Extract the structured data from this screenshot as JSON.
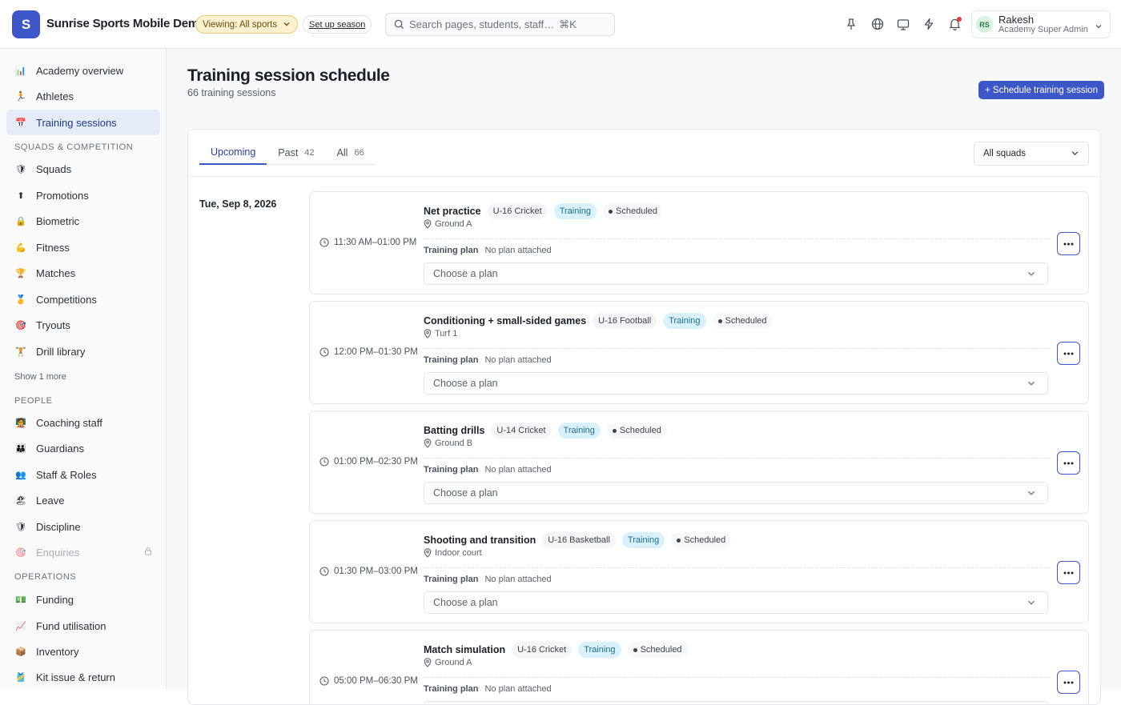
{
  "app": {
    "logo_letter": "S",
    "title": "Sunrise Sports Mobile Demo"
  },
  "header": {
    "viewing_label": "Viewing: All sports",
    "setup_label": "Set up season",
    "search_placeholder": "Search pages, students, staff…",
    "search_shortcut": "⌘K",
    "icons": [
      "pin-icon",
      "globe-icon",
      "monitor-icon",
      "lightning-icon",
      "bell-icon"
    ],
    "user": {
      "initials": "RS",
      "name": "Rakesh",
      "role": "Academy Super Admin"
    }
  },
  "sidebar": {
    "top_items": [
      {
        "emoji": "📊",
        "label": "Academy overview"
      },
      {
        "emoji": "🏃",
        "label": "Athletes"
      },
      {
        "emoji": "📅",
        "label": "Training sessions",
        "active": true
      }
    ],
    "sections": [
      {
        "label": "SQUADS & COMPETITION",
        "items": [
          {
            "emoji": "🛡",
            "label": "Squads"
          },
          {
            "emoji": "⬆",
            "label": "Promotions"
          },
          {
            "emoji": "🔒",
            "label": "Biometric"
          },
          {
            "emoji": "💪",
            "label": "Fitness"
          },
          {
            "emoji": "🏆",
            "label": "Matches"
          },
          {
            "emoji": "🥇",
            "label": "Competitions"
          },
          {
            "emoji": "🎯",
            "label": "Tryouts"
          },
          {
            "emoji": "🏋",
            "label": "Drill library"
          }
        ],
        "show_more": "Show 1 more"
      },
      {
        "label": "PEOPLE",
        "items": [
          {
            "emoji": "🧑‍🏫",
            "label": "Coaching staff"
          },
          {
            "emoji": "👪",
            "label": "Guardians"
          },
          {
            "emoji": "👥",
            "label": "Staff & Roles"
          },
          {
            "emoji": "🏖",
            "label": "Leave"
          },
          {
            "emoji": "🛡",
            "label": "Discipline"
          },
          {
            "emoji": "🎯",
            "label": "Enquiries",
            "locked": true
          }
        ]
      },
      {
        "label": "OPERATIONS",
        "items": [
          {
            "emoji": "💵",
            "label": "Funding"
          },
          {
            "emoji": "📈",
            "label": "Fund utilisation"
          },
          {
            "emoji": "📦",
            "label": "Inventory"
          },
          {
            "emoji": "🎽",
            "label": "Kit issue & return"
          }
        ]
      }
    ]
  },
  "main": {
    "title": "Training session schedule",
    "subtitle": "66 training sessions",
    "primary_button": "+ Schedule training session",
    "tabs": [
      {
        "label": "Upcoming",
        "count": "",
        "active": true
      },
      {
        "label": "Past",
        "count": "42"
      },
      {
        "label": "All",
        "count": "66"
      }
    ],
    "squad_filter": "All squads",
    "date": "Tue, Sep 8, 2026",
    "plan_label": "Training plan",
    "plan_value": "No plan attached",
    "plan_placeholder": "Choose a plan",
    "sessions": [
      {
        "time": "11:30 AM–01:00 PM",
        "title": "Net practice",
        "squad": "U-16 Cricket",
        "type": "Training",
        "status": "Scheduled",
        "location": "Ground A"
      },
      {
        "time": "12:00 PM–01:30 PM",
        "title": "Conditioning + small-sided games",
        "squad": "U-16 Football",
        "type": "Training",
        "status": "Scheduled",
        "location": "Turf 1"
      },
      {
        "time": "01:00 PM–02:30 PM",
        "title": "Batting drills",
        "squad": "U-14 Cricket",
        "type": "Training",
        "status": "Scheduled",
        "location": "Ground B"
      },
      {
        "time": "01:30 PM–03:00 PM",
        "title": "Shooting and transition",
        "squad": "U-16 Basketball",
        "type": "Training",
        "status": "Scheduled",
        "location": "Indoor court"
      },
      {
        "time": "05:00 PM–06:30 PM",
        "title": "Match simulation",
        "squad": "U-16 Cricket",
        "type": "Training",
        "status": "Scheduled",
        "location": "Ground A"
      }
    ]
  }
}
